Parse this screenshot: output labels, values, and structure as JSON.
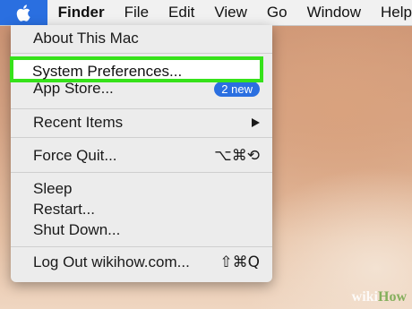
{
  "menubar": {
    "apple_icon": "apple-logo",
    "items": [
      "Finder",
      "File",
      "Edit",
      "View",
      "Go",
      "Window",
      "Help"
    ]
  },
  "apple_menu": {
    "about": "About This Mac",
    "system_preferences": "System Preferences...",
    "app_store": "App Store...",
    "app_store_badge": "2 new",
    "recent_items": "Recent Items",
    "force_quit": "Force Quit...",
    "force_quit_shortcut": "⌥⌘⟲",
    "sleep": "Sleep",
    "restart": "Restart...",
    "shut_down": "Shut Down...",
    "log_out": "Log Out wikihow.com...",
    "log_out_shortcut": "⇧⌘Q"
  },
  "colors": {
    "highlight_border": "#36e21a",
    "accent_blue": "#2b6fe0"
  },
  "watermark": {
    "wiki": "wiki",
    "how": "How"
  }
}
